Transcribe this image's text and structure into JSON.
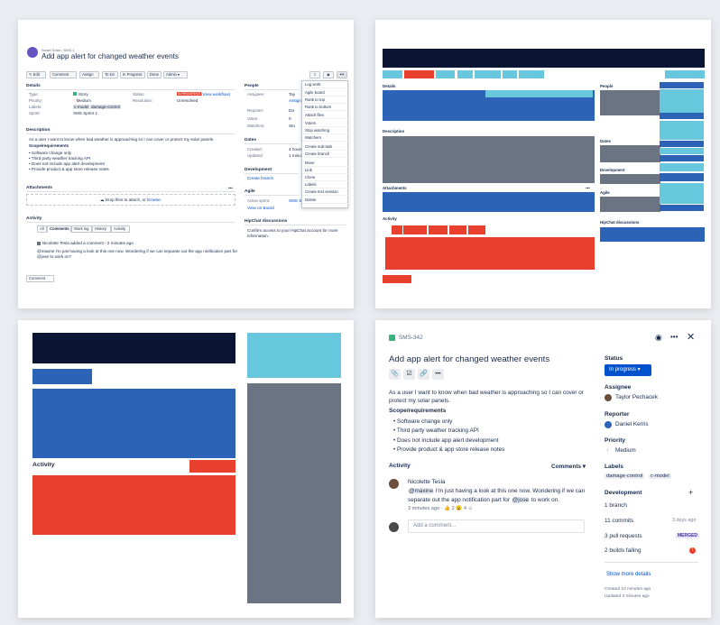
{
  "colors": {
    "navy": "#0a1533",
    "blue": "#2d63b7",
    "cyan": "#66c7dd",
    "red": "#e8402c",
    "gray": "#6b7483",
    "accent": "#0052cc"
  },
  "p1": {
    "breadcrumb": "Smart Solar  /  SMS-1",
    "title": "Add app alert for changed weather events",
    "toolbar": {
      "edit": "✎ Edit",
      "comment": "Comment",
      "assign": "Assign",
      "todo": "To Do",
      "inprogress": "In Progress",
      "done": "Done",
      "admin": "Admin ▾"
    },
    "details_h": "Details",
    "details": {
      "type_l": "Type:",
      "type_v": "Story",
      "priority_l": "Priority:",
      "priority_v": "Medium",
      "labels_l": "Labels:",
      "label1": "c-model",
      "label2": "damage-control",
      "sprint_l": "Sprint:",
      "sprint_v": "SMS Sprint 1",
      "status_l": "Status:",
      "status_v": "IN PROGRESS",
      "status_link": "(View workflow)",
      "resolution_l": "Resolution:",
      "resolution_v": "Unresolved"
    },
    "description_h": "Description",
    "description": "As a user I want to know when bad weather is approaching so I can cover or protect my solar panels.",
    "scope_h": "Scope/requirements",
    "scope": [
      "• Software change only",
      "• Third party weather tracking API",
      "• Does not include app alert development",
      "• Provide product & app store release notes"
    ],
    "attachments_h": "Attachments",
    "drop_text": "Drop files to attach, or ",
    "drop_link": "browse.",
    "activity_h": "Activity",
    "tabs": [
      "All",
      "Comments",
      "Work log",
      "History",
      "Activity"
    ],
    "comment_author": "Nicolette Tesla added a comment - 2 minutes ago",
    "comment_text_1": "@maxine I'm just having a look at this one now. Wondering if we can separate out the app notification part for",
    "comment_text_2": "@jose to work on?",
    "comment_btn": "Comment",
    "people_h": "People",
    "assignee_l": "Assignee:",
    "assignee_v": "Tay",
    "assign_me": "Assign",
    "reporter_l": "Reporter:",
    "reporter_v": "Da",
    "votes_l": "Votes:",
    "votes_v": "0",
    "watchers_l": "Watchers:",
    "watchers_v": "Sto",
    "dates_h": "Dates",
    "created_l": "Created:",
    "created_v": "4 hours",
    "updated_l": "Updated:",
    "updated_v": "1 minute",
    "development_h": "Development",
    "create_branch": "Create branch",
    "agile_h": "Agile",
    "active_sprint_l": "Active sprint:",
    "active_sprint_v": "SMS Sp",
    "view_on_board": "View on Board",
    "hipchat_h": "HipChat discussions",
    "hipchat_text_1": "Confirm access to your HipChat account for more",
    "hipchat_text_2": "information.",
    "menu": [
      "Log work",
      "Agile board",
      "Rank to top",
      "Rank to bottom",
      "Attach files",
      "Voters",
      "Stop watching",
      "Watchers",
      "Create sub-task",
      "Create branch",
      "Move",
      "Link",
      "Clone",
      "Labels",
      "Create test session",
      "Delete"
    ]
  },
  "p2": {
    "details_h": "Details",
    "description_h": "Description",
    "attachments_h": "Attachments",
    "attach_more": "•••",
    "activity_h": "Activity",
    "people_h": "People",
    "dates_h": "Dates",
    "development_h": "Development",
    "agile_h": "Agile",
    "hipchat_h": "HipChat discussions"
  },
  "p3": {
    "activity_h": "Activity"
  },
  "p4": {
    "issue_key": "SMS-342",
    "title": "Add app alert for changed weather events",
    "description": "As a user I want to know when bad weather is approaching so I can cover or",
    "description2": "protect my solar panels.",
    "scope_h": "Scope/requirements",
    "scope": [
      "Software change only",
      "Third party weather tracking API",
      "Does not include app alert development",
      "Provide product & app store release notes"
    ],
    "activity_h": "Activity",
    "comments_dd": "Comments ▾",
    "commenter": "Nicolette Tesla",
    "mention1": "@maxine",
    "comment_a": " I'm just having a look at this one now. Wondering if we can",
    "comment_b": "separate out the app notification part for ",
    "mention2": "@jose",
    "comment_c": " to work on.",
    "comment_meta": "3 minutes ago · 👍 2  😮 4  ☺",
    "add_comment": "Add a comment...",
    "status_h": "Status",
    "status_v": "In progress",
    "assignee_h": "Assignee",
    "assignee_v": "Taylor Pechacek",
    "reporter_h": "Reporter",
    "reporter_v": "Daniel Kerris",
    "priority_h": "Priority",
    "priority_v": "Medium",
    "labels_h": "Labels",
    "label1": "damage-control",
    "label2": "c-model",
    "dev_h": "Development",
    "branch": "1 branch",
    "commits": "11 commits",
    "commits_when": "3 days ago",
    "prs": "3 pull requests",
    "merged": "MERGED",
    "builds": "2 builds failing",
    "show_more": "Show more details",
    "created": "Created 10 minutes ago",
    "updated": "Updated 3 minutes ago"
  }
}
